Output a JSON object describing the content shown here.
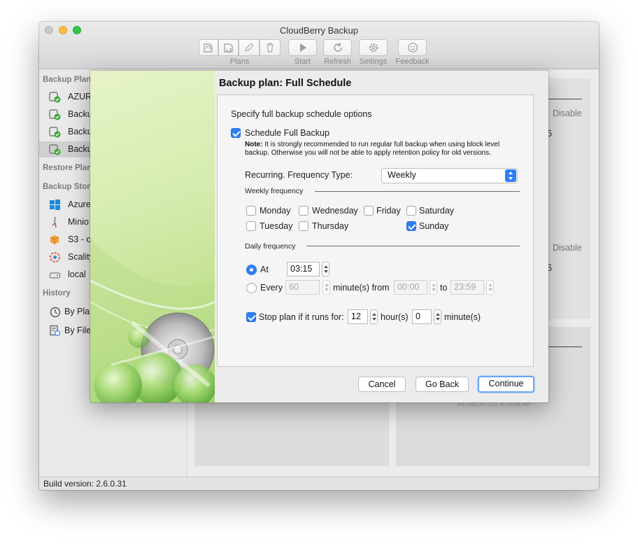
{
  "window": {
    "title": "CloudBerry Backup",
    "toolbar": {
      "plans_label": "Plans",
      "start_label": "Start",
      "refresh_label": "Refresh",
      "settings_label": "Settings",
      "feedback_label": "Feedback"
    },
    "status_bar": "Build version: 2.6.0.31"
  },
  "sidebar": {
    "backup_plans_header": "Backup Plans",
    "backup_plans": [
      {
        "label": "AZURE",
        "icon": "backup-plan-ok-icon"
      },
      {
        "label": "Backup",
        "icon": "backup-plan-ok-icon"
      },
      {
        "label": "Backup",
        "icon": "backup-plan-ok-icon"
      },
      {
        "label": "Backup",
        "icon": "backup-plan-ok-icon"
      }
    ],
    "restore_plans_header": "Restore Plans",
    "backup_storages_header": "Backup Storages",
    "storages": [
      {
        "label": "Azure",
        "icon": "windows-azure-icon"
      },
      {
        "label": "Minio",
        "icon": "minio-icon"
      },
      {
        "label": "S3 - c",
        "icon": "s3-icon"
      },
      {
        "label": "Scality",
        "icon": "scality-icon"
      },
      {
        "label": "local",
        "icon": "local-disk-icon"
      }
    ],
    "history_header": "History",
    "history": [
      {
        "label": "By Plan",
        "icon": "history-clock-icon"
      },
      {
        "label": "By File",
        "icon": "file-history-icon"
      }
    ]
  },
  "background": {
    "disable_1": "Disable",
    "disable_2": "Disable",
    "digit_1": "5",
    "digit_2": "5",
    "storage_caption": "Amazon S3 & Glacier"
  },
  "dialog": {
    "title": "Backup plan: Full Schedule",
    "intro": "Specify full backup schedule options",
    "schedule_full_backup": {
      "label": "Schedule Full Backup",
      "checked": true
    },
    "note_label": "Note:",
    "note_text": " It is strongly recommended to run regular full backup when using block level backup. Otherwise you will not be able to apply retention policy for old versions.",
    "recurring_label": "Recurring. Frequency Type:",
    "frequency_type": "Weekly",
    "weekly_frequency_label": "Weekly frequency",
    "days": {
      "monday": {
        "label": "Monday",
        "checked": false
      },
      "wednesday": {
        "label": "Wednesday",
        "checked": false
      },
      "friday": {
        "label": "Friday",
        "checked": false
      },
      "saturday": {
        "label": "Saturday",
        "checked": false
      },
      "tuesday": {
        "label": "Tuesday",
        "checked": false
      },
      "thursday": {
        "label": "Thursday",
        "checked": false
      },
      "sunday": {
        "label": "Sunday",
        "checked": true
      }
    },
    "daily_frequency_label": "Daily frequency",
    "at_label": "At",
    "at_time": "03:15",
    "at_selected": true,
    "every_label": "Every",
    "every_value": "60",
    "minutes_from_label": "minute(s) from",
    "from_time": "00:00",
    "to_label": "to",
    "to_time": "23:59",
    "stop_plan_label": "Stop plan if it runs for:",
    "stop_plan_checked": true,
    "stop_hours": "12",
    "hours_label": "hour(s)",
    "stop_minutes": "0",
    "minutes_label": "minute(s)",
    "cancel_label": "Cancel",
    "go_back_label": "Go Back",
    "continue_label": "Continue"
  }
}
